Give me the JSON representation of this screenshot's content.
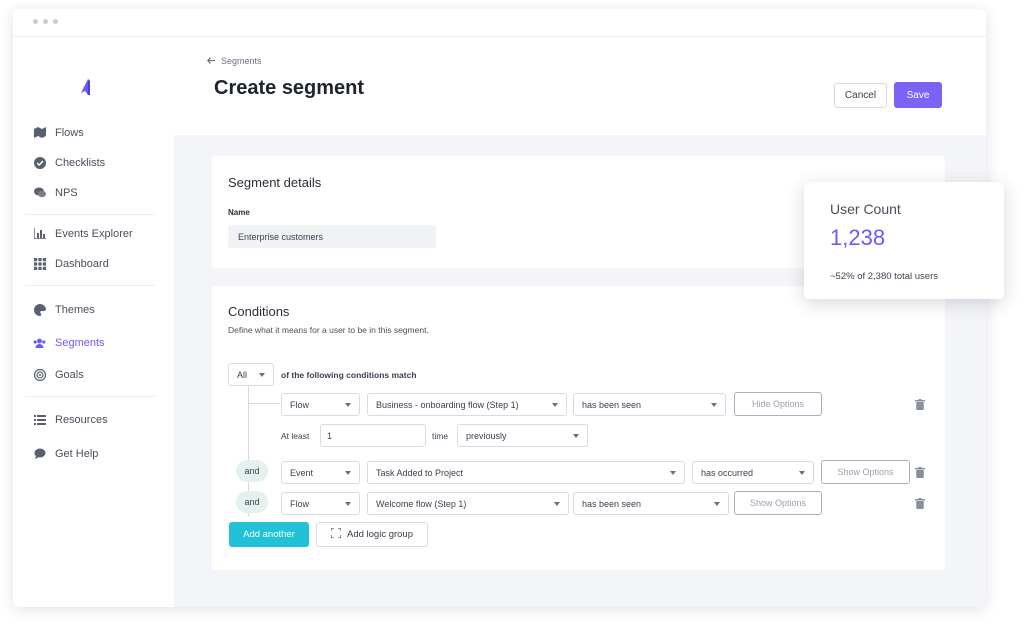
{
  "sidebar": {
    "items": [
      {
        "label": "Flows",
        "icon": "map-icon"
      },
      {
        "label": "Checklists",
        "icon": "check-circle-icon"
      },
      {
        "label": "NPS",
        "icon": "chat-icon"
      },
      {
        "label": "Events Explorer",
        "icon": "bar-chart-icon"
      },
      {
        "label": "Dashboard",
        "icon": "grid-icon"
      },
      {
        "label": "Themes",
        "icon": "palette-icon"
      },
      {
        "label": "Segments",
        "icon": "users-icon"
      },
      {
        "label": "Goals",
        "icon": "target-icon"
      },
      {
        "label": "Resources",
        "icon": "list-icon"
      },
      {
        "label": "Get Help",
        "icon": "help-bubble-icon"
      }
    ],
    "active": "Segments",
    "accent": "#6b5bf5"
  },
  "header": {
    "back_label": "Segments",
    "title": "Create segment",
    "cancel_label": "Cancel",
    "save_label": "Save"
  },
  "details": {
    "title": "Segment details",
    "name_label": "Name",
    "name_value": "Enterprise customers"
  },
  "conditions": {
    "title": "Conditions",
    "description": "Define what it means for a user to be in this segment.",
    "match_value": "All",
    "match_text": "of the following conditions match",
    "rows": [
      {
        "type": "Flow",
        "target": "Business - onboarding flow (Step 1)",
        "state": "has been seen",
        "options_label": "Hide Options"
      },
      {
        "connector": "and",
        "type": "Event",
        "target": "Task Added to Project",
        "state": "has occurred",
        "options_label": "Show Options"
      },
      {
        "connector": "and",
        "type": "Flow",
        "target": "Welcome flow (Step 1)",
        "state": "has been seen",
        "options_label": "Show Options"
      }
    ],
    "options": {
      "at_least_label": "At least",
      "at_least_value": "1",
      "time_label": "time",
      "time_value": "previously"
    },
    "add_another_label": "Add another",
    "add_logic_group_label": "Add logic group"
  },
  "user_count": {
    "title": "User Count",
    "count": "1,238",
    "subtitle": "~52% of 2,380 total users"
  },
  "colors": {
    "primary": "#7b63f6",
    "teal": "#22c2d6",
    "and_pill": "#e4f1ee"
  }
}
